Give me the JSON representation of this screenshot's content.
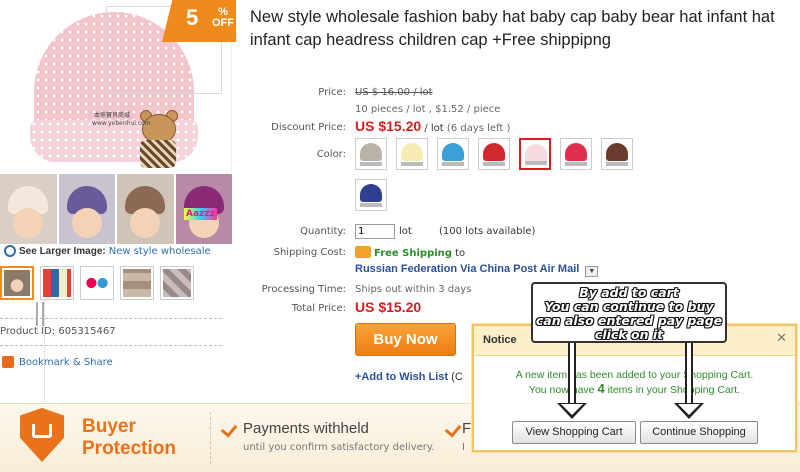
{
  "badge": {
    "percent": "5",
    "pct_sign": "%",
    "off": "OFF"
  },
  "product": {
    "title": "New style wholesale fashion baby hat baby cap baby bear hat infant hat infant cap headress children cap +Free shippipng",
    "image_caption": "本熊寶貝商城 www.yebenhui.com",
    "colorful_tag": "Aazzz",
    "see_larger_label": "See Larger Image:",
    "see_larger_link": "New style wholesale",
    "product_id": "Product ID: 605315467",
    "bookmark": "Bookmark & Share"
  },
  "details": {
    "price_label": "Price:",
    "price_value": "US $ 16.00 / lot",
    "price_sub": "10 pieces / lot , $1.52 / piece",
    "discount_label": "Discount Price:",
    "discount_value": "US $15.20",
    "discount_unit": "/ lot",
    "discount_note": "(6 days left )",
    "color_label": "Color:",
    "colors": [
      "#b9b2a8",
      "#f4ecb3",
      "#3aa0d6",
      "#d0282c",
      "#f7d9de",
      "#e0304e",
      "#6b3b2e",
      "#2d3f8e"
    ],
    "selected_color_index": 4,
    "quantity_label": "Quantity:",
    "quantity_value": "1",
    "quantity_unit": "lot",
    "quantity_avail": "(100 lots available)",
    "shipping_label": "Shipping Cost:",
    "shipping_free": "Free Shipping",
    "shipping_to": "to",
    "shipping_method": "Russian Federation Via China Post Air Mail",
    "processing_label": "Processing Time:",
    "processing_value": "Ships out within 3 days",
    "total_label": "Total Price:",
    "total_value": "US $15.20",
    "buy_now": "Buy Now",
    "wishlist": "+Add to Wish List",
    "wishlist_trail": "(C"
  },
  "protection": {
    "title_line1": "Buyer",
    "title_line2": "Protection",
    "item1_title": "Payments withheld",
    "item1_sub": "until you confirm satisfactory delivery.",
    "item2_title": "F",
    "item2_sub": "I"
  },
  "notice": {
    "title": "Notice",
    "close": "✕",
    "msg_line1": "A new item has been added to your Shopping Cart.",
    "msg_line2_pre": "You now have",
    "msg_count": "4",
    "msg_line2_post": "items in your Shopping Cart.",
    "view_cart": "View Shopping Cart",
    "continue": "Continue Shopping"
  },
  "annotation": {
    "line1": "By add to cart",
    "line2": "You can continue to buy",
    "line3": "can also entered pay page",
    "line4": "click on it"
  },
  "colors": {
    "accent": "#f08a1c",
    "price_red": "#d71e1e",
    "link_blue": "#2c4f9c",
    "notice_border": "#f0c56a"
  }
}
